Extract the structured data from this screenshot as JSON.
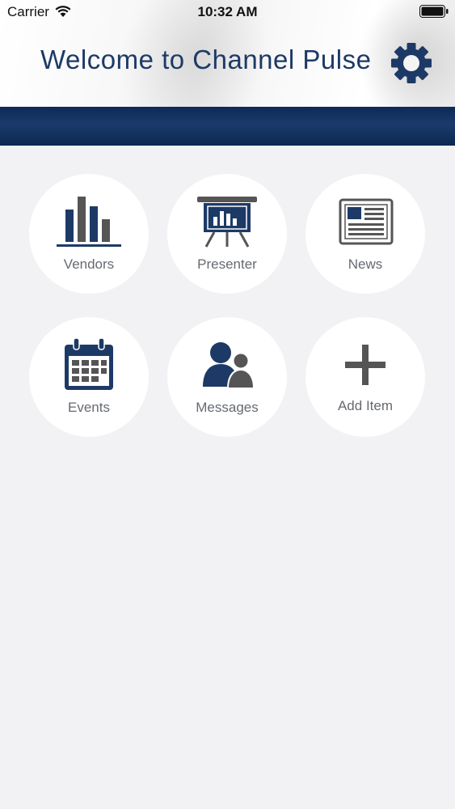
{
  "status_bar": {
    "carrier": "Carrier",
    "time": "10:32 AM"
  },
  "header": {
    "title": "Welcome to Channel Pulse",
    "settings_icon": "gear-icon"
  },
  "colors": {
    "brand_navy": "#1d3a66",
    "band": "#0d2a57",
    "icon_gray": "#555555",
    "label_gray": "#666a70"
  },
  "menu": {
    "items": [
      {
        "label": "Vendors",
        "icon": "bar-chart-icon"
      },
      {
        "label": "Presenter",
        "icon": "presentation-board-icon"
      },
      {
        "label": "News",
        "icon": "newspaper-icon"
      },
      {
        "label": "Events",
        "icon": "calendar-icon"
      },
      {
        "label": "Messages",
        "icon": "users-icon"
      },
      {
        "label": "Add Item",
        "icon": "plus-icon"
      }
    ]
  }
}
